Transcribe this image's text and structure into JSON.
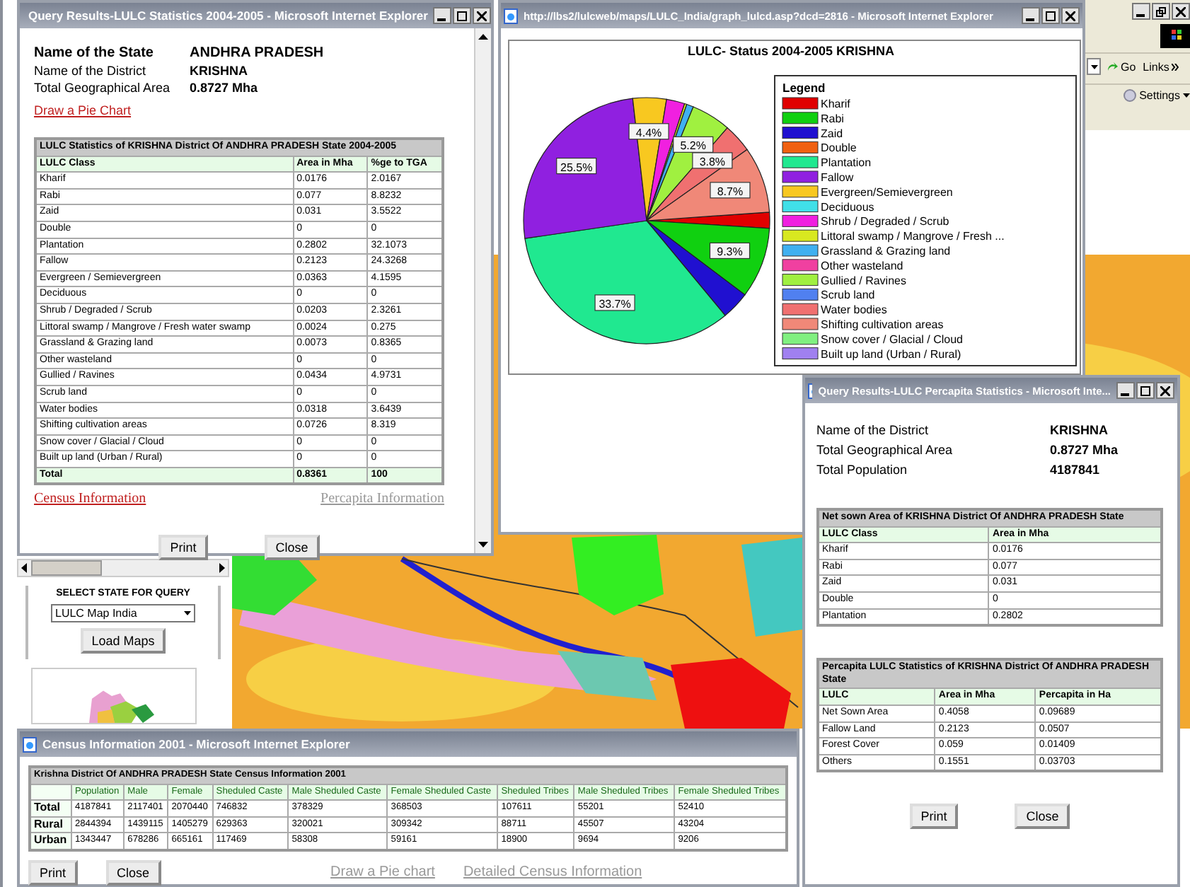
{
  "browser": {
    "toolbar": {
      "go": "Go",
      "links": "Links",
      "settings": "Settings"
    },
    "left_panel": {
      "heading": "SELECT STATE FOR QUERY",
      "select_value": "LULC Map India",
      "button": "Load Maps"
    }
  },
  "stats_window": {
    "title": "Query Results-LULC Statistics 2004-2005 - Microsoft Internet Explorer",
    "fields": [
      {
        "label": "Name of the State",
        "value": "ANDHRA PRADESH",
        "emphasis": true
      },
      {
        "label": "Name of the District",
        "value": "KRISHNA",
        "emphasis": false
      },
      {
        "label": "Total Geographical Area",
        "value": "0.8727 Mha",
        "emphasis": false
      }
    ],
    "pie_link": "Draw a Pie Chart",
    "table": {
      "caption": "LULC Statistics of  KRISHNA District Of ANDHRA PRADESH State 2004-2005",
      "columns": [
        "LULC Class",
        "Area in Mha",
        "%ge to TGA"
      ],
      "rows": [
        [
          "Kharif",
          "0.0176",
          "2.0167"
        ],
        [
          "Rabi",
          "0.077",
          "8.8232"
        ],
        [
          "Zaid",
          "0.031",
          "3.5522"
        ],
        [
          "Double",
          "0",
          "0"
        ],
        [
          "Plantation",
          "0.2802",
          "32.1073"
        ],
        [
          "Fallow",
          "0.2123",
          "24.3268"
        ],
        [
          "Evergreen / Semievergreen",
          "0.0363",
          "4.1595"
        ],
        [
          "Deciduous",
          "0",
          "0"
        ],
        [
          "Shrub / Degraded / Scrub",
          "0.0203",
          "2.3261"
        ],
        [
          "Littoral swamp / Mangrove / Fresh water swamp",
          "0.0024",
          "0.275"
        ],
        [
          "Grassland & Grazing land",
          "0.0073",
          "0.8365"
        ],
        [
          "Other wasteland",
          "0",
          "0"
        ],
        [
          "Gullied / Ravines",
          "0.0434",
          "4.9731"
        ],
        [
          "Scrub land",
          "0",
          "0"
        ],
        [
          "Water bodies",
          "0.0318",
          "3.6439"
        ],
        [
          "Shifting cultivation areas",
          "0.0726",
          "8.319"
        ],
        [
          "Snow cover / Glacial / Cloud",
          "0",
          "0"
        ],
        [
          "Built up land (Urban / Rural)",
          "0",
          "0"
        ]
      ],
      "total": [
        "Total",
        "0.8361",
        "100"
      ]
    },
    "links": [
      {
        "text": "Census Information",
        "dimmed": false
      },
      {
        "text": "Percapita Information",
        "dimmed": true
      }
    ],
    "buttons": [
      "Print",
      "Close"
    ]
  },
  "chart_window": {
    "title": "http://lbs2/lulcweb/maps/LULC_India/graph_lulcd.asp?dcd=2816 - Microsoft Internet Explorer",
    "chart_data": {
      "type": "pie",
      "title": "LULC- Status 2004-2005  KRISHNA",
      "legend": {
        "title": "Legend"
      },
      "value_labels": [
        null,
        "9.3%",
        null,
        null,
        "33.7%",
        "25.5%",
        "4.4%",
        null,
        null,
        null,
        null,
        null,
        "5.2%",
        null,
        "3.8%",
        "8.7%",
        null,
        null
      ],
      "categories": [
        "Kharif",
        "Rabi",
        "Zaid",
        "Double",
        "Plantation",
        "Fallow",
        "Evergreen/Semievergreen",
        "Deciduous",
        "Shrub / Degraded / Scrub",
        "Littoral swamp / Mangrove / Fresh ...",
        "Grassland & Grazing land",
        "Other wasteland",
        "Gullied / Ravines",
        "Scrub land",
        "Water bodies",
        "Shifting cultivation areas",
        "Snow cover / Glacial / Cloud",
        "Built up land (Urban / Rural)"
      ],
      "values": [
        2.1,
        9.3,
        3.7,
        0,
        33.7,
        25.5,
        4.4,
        0,
        2.4,
        0.3,
        0.9,
        0,
        5.2,
        0,
        3.8,
        8.7,
        0,
        0
      ],
      "colors": [
        "#e00000",
        "#10d010",
        "#2010d0",
        "#f06010",
        "#20e890",
        "#9020e0",
        "#f8c820",
        "#40e0e8",
        "#f020e0",
        "#d8e820",
        "#40b0f0",
        "#f040a0",
        "#a0f040",
        "#5080f0",
        "#f07070",
        "#f08878",
        "#80f080",
        "#a080f0"
      ]
    }
  },
  "percapita_window": {
    "title": "Query Results-LULC Percapita Statistics - Microsoft Inte...",
    "fields": [
      {
        "label": "Name of the District",
        "value": "KRISHNA"
      },
      {
        "label": "Total Geographical Area",
        "value": "0.8727 Mha"
      },
      {
        "label": "Total Population",
        "value": "4187841"
      }
    ],
    "tables": [
      {
        "caption": "Net sown Area of  KRISHNA District Of ANDHRA PRADESH State",
        "columns": [
          "LULC Class",
          "Area in Mha"
        ],
        "rows": [
          [
            "Kharif",
            "0.0176"
          ],
          [
            "Rabi",
            "0.077"
          ],
          [
            "Zaid",
            "0.031"
          ],
          [
            "Double",
            "0"
          ],
          [
            "Plantation",
            "0.2802"
          ]
        ]
      },
      {
        "caption": "Percapita LULC Statistics of  KRISHNA District Of ANDHRA PRADESH State",
        "columns": [
          "LULC",
          "Area in Mha",
          "Percapita in Ha"
        ],
        "rows": [
          [
            "Net Sown Area",
            "0.4058",
            "0.09689"
          ],
          [
            "Fallow Land",
            "0.2123",
            "0.0507"
          ],
          [
            "Forest Cover",
            "0.059",
            "0.01409"
          ],
          [
            "Others",
            "0.1551",
            "0.03703"
          ]
        ]
      }
    ],
    "buttons": [
      "Print",
      "Close"
    ]
  },
  "census_window": {
    "title": "Census Information 2001 - Microsoft Internet Explorer",
    "table": {
      "caption": "Krishna District Of ANDHRA PRADESH State Census Information 2001",
      "header_row": [
        "Population",
        "Male",
        "Female",
        "Sheduled Caste",
        "Male Sheduled Caste",
        "Female Sheduled Caste",
        "Sheduled Tribes",
        "Male Sheduled Tribes",
        "Female Sheduled Tribes"
      ],
      "rows": [
        {
          "label": "Total",
          "cells": [
            "4187841",
            "2117401",
            "2070440",
            "746832",
            "378329",
            "368503",
            "107611",
            "55201",
            "52410"
          ]
        },
        {
          "label": "Rural",
          "cells": [
            "2844394",
            "1439115",
            "1405279",
            "629363",
            "320021",
            "309342",
            "88711",
            "45507",
            "43204"
          ]
        },
        {
          "label": "Urban",
          "cells": [
            "1343447",
            "678286",
            "665161",
            "117469",
            "58308",
            "59161",
            "18900",
            "9694",
            "9206"
          ]
        }
      ]
    },
    "buttons": [
      "Print",
      "Close"
    ],
    "links": [
      {
        "text": "Draw a Pie chart",
        "dimmed": true
      },
      {
        "text": "Detailed Census Information",
        "dimmed": true
      }
    ]
  }
}
